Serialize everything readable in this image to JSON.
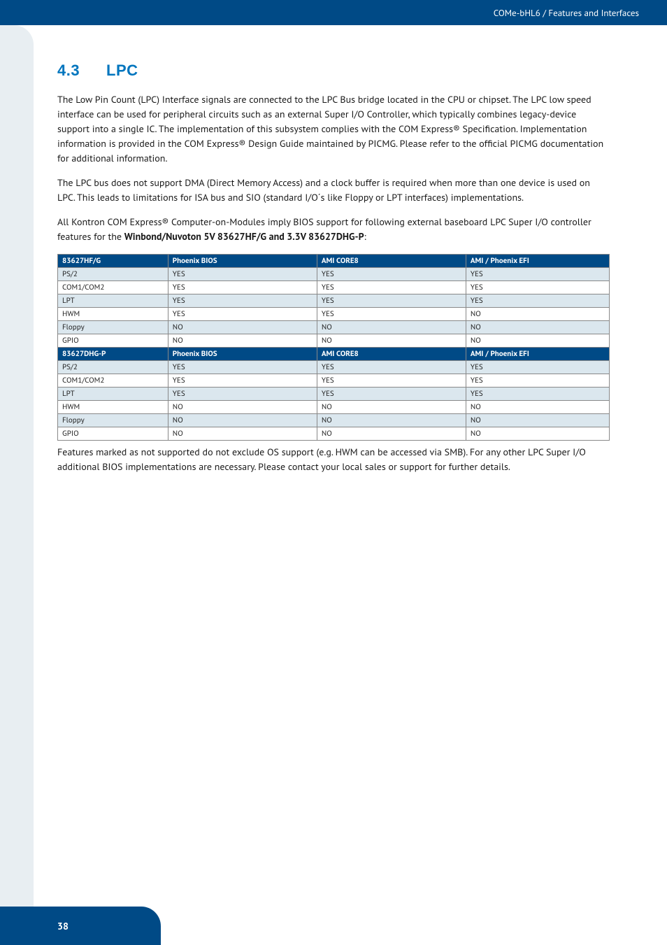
{
  "header": {
    "breadcrumb": "COMe-bHL6 / Features and Interfaces"
  },
  "section": {
    "number": "4.3",
    "title": "LPC"
  },
  "paragraphs": {
    "p1": "The Low Pin Count (LPC) Interface signals are connected to the LPC Bus bridge located in the CPU or chipset. The LPC low speed interface can be used for peripheral circuits such as an external Super I/O Controller, which typically combines legacy-device support into a single IC. The implementation of this subsystem complies with the COM Express® Specification. Implementation information is provided in the COM Express® Design Guide maintained by PICMG. Please refer to the official PICMG documentation for additional information.",
    "p2": "The LPC bus does not support DMA (Direct Memory Access) and a clock buffer is required when more than one device is used on LPC. This leads to limitations for ISA bus and SIO (standard I/O´s like Floppy or LPT interfaces) implementations.",
    "p3a": "All Kontron COM Express® Computer-on-Modules imply BIOS support for following external baseboard LPC Super I/O controller features for the ",
    "p3b": "Winbond/Nuvoton 5V 83627HF/G and 3.3V 83627DHG-P",
    "p3c": ":",
    "foot": " Features marked as not supported do not exclude OS support (e.g. HWM can be accessed via SMB). For any other LPC Super I/O additional BIOS implementations are necessary. Please contact your local sales or support for further details."
  },
  "chart_data": {
    "type": "table",
    "tables": [
      {
        "header": [
          "83627HF/G",
          "Phoenix BIOS",
          "AMI CORE8",
          "AMI / Phoenix EFI"
        ],
        "rows": [
          {
            "feature": "PS/2",
            "phoenix": "YES",
            "ami8": "YES",
            "efi": "YES",
            "hlt": true
          },
          {
            "feature": "COM1/COM2",
            "phoenix": "YES",
            "ami8": "YES",
            "efi": "YES",
            "hlt": false
          },
          {
            "feature": "LPT",
            "phoenix": "YES",
            "ami8": "YES",
            "efi": "YES",
            "hlt": true
          },
          {
            "feature": "HWM",
            "phoenix": "YES",
            "ami8": "YES",
            "efi": "NO",
            "hlt": false
          },
          {
            "feature": "Floppy",
            "phoenix": "NO",
            "ami8": "NO",
            "efi": "NO",
            "hlt": true
          },
          {
            "feature": "GPIO",
            "phoenix": "NO",
            "ami8": "NO",
            "efi": "NO",
            "hlt": false
          }
        ]
      },
      {
        "header": [
          "83627DHG-P",
          "Phoenix BIOS",
          "AMI CORE8",
          "AMI / Phoenix EFI"
        ],
        "rows": [
          {
            "feature": "PS/2",
            "phoenix": "YES",
            "ami8": "YES",
            "efi": "YES",
            "hlt": true
          },
          {
            "feature": "COM1/COM2",
            "phoenix": "YES",
            "ami8": "YES",
            "efi": "YES",
            "hlt": false
          },
          {
            "feature": "LPT",
            "phoenix": "YES",
            "ami8": "YES",
            "efi": "YES",
            "hlt": true
          },
          {
            "feature": "HWM",
            "phoenix": "NO",
            "ami8": "NO",
            "efi": "NO",
            "hlt": false
          },
          {
            "feature": "Floppy",
            "phoenix": "NO",
            "ami8": "NO",
            "efi": "NO",
            "hlt": true
          },
          {
            "feature": "GPIO",
            "phoenix": "NO",
            "ami8": "NO",
            "efi": "NO",
            "hlt": false
          }
        ]
      }
    ]
  },
  "page": {
    "number": "38"
  }
}
